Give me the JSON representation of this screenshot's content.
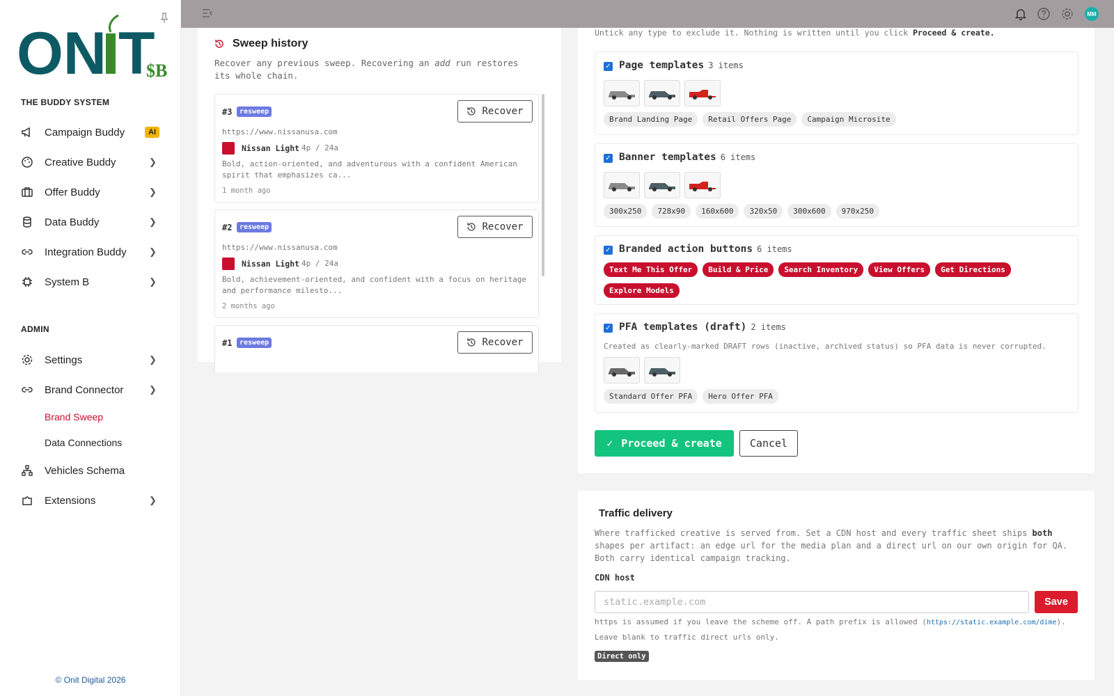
{
  "brand": {
    "logo_text": "ONiT",
    "logo_sub": "$B",
    "section_label": "THE BUDDY SYSTEM",
    "copyright": "© Onit Digital 2026"
  },
  "nav": [
    {
      "label": "Campaign Buddy",
      "icon": "megaphone-icon",
      "badge": "AI"
    },
    {
      "label": "Creative Buddy",
      "icon": "palette-icon"
    },
    {
      "label": "Offer Buddy",
      "icon": "briefcase-icon"
    },
    {
      "label": "Data Buddy",
      "icon": "database-icon"
    },
    {
      "label": "Integration Buddy",
      "icon": "link-icon"
    },
    {
      "label": "System B",
      "icon": "chip-icon"
    }
  ],
  "admin": {
    "label": "ADMIN",
    "items": [
      {
        "label": "Settings",
        "icon": "gear-icon"
      },
      {
        "label": "Brand Connector",
        "icon": "link-icon"
      },
      {
        "label": "Brand Sweep",
        "sub": true,
        "active": true
      },
      {
        "label": "Data Connections",
        "sub": true
      },
      {
        "label": "Vehicles Schema",
        "icon": "hierarchy-icon"
      },
      {
        "label": "Extensions",
        "icon": "puzzle-icon"
      }
    ]
  },
  "topbar": {
    "avatar_initials": "MM"
  },
  "history": {
    "title": "Sweep history",
    "desc_pre": "Recover any previous sweep. Recovering an ",
    "desc_em": "add",
    "desc_post": " run restores its whole chain.",
    "recover_label": "Recover",
    "entries": [
      {
        "num": "#3",
        "badge": "resweep",
        "url": "https://www.nissanusa.com",
        "brand": "Nissan Light",
        "meta": "4p / 24a",
        "summary": "Bold, action-oriented, and adventurous with a confident American spirit that emphasizes ca...",
        "ago": "1 month ago"
      },
      {
        "num": "#2",
        "badge": "resweep",
        "url": "https://www.nissanusa.com",
        "brand": "Nissan Light",
        "meta": "4p / 24a",
        "summary": "Bold, achievement-oriented, and confident with a focus on heritage and performance milesto...",
        "ago": "2 months ago"
      },
      {
        "num": "#1",
        "badge": "resweep"
      }
    ]
  },
  "review": {
    "intro_pre": "Untick any type to exclude it. Nothing is written until you click ",
    "intro_b": "Proceed & create.",
    "groups": {
      "page": {
        "title": "Page templates",
        "count": "3 items",
        "chips": [
          "Brand Landing Page",
          "Retail Offers Page",
          "Campaign Microsite"
        ]
      },
      "banner": {
        "title": "Banner templates",
        "count": "6 items",
        "chips": [
          "300x250",
          "728x90",
          "160x600",
          "320x50",
          "300x600",
          "970x250"
        ]
      },
      "buttons": {
        "title": "Branded action buttons",
        "count": "6 items",
        "chips": [
          "Text Me This Offer",
          "Build & Price",
          "Search Inventory",
          "View Offers",
          "Get Directions",
          "Explore Models"
        ]
      },
      "pfa": {
        "title": "PFA templates (draft)",
        "count": "2 items",
        "note": "Created as clearly-marked DRAFT rows (inactive, archived status) so PFA data is never corrupted.",
        "chips": [
          "Standard Offer PFA",
          "Hero Offer PFA"
        ]
      }
    },
    "proceed_label": "Proceed & create",
    "cancel_label": "Cancel"
  },
  "traffic": {
    "title": "Traffic delivery",
    "desc_pre": "Where trafficked creative is served from. Set a CDN host and every traffic sheet ships ",
    "desc_b": "both",
    "desc_post": " shapes per artifact: an edge url for the media plan and a direct url on our own origin for QA. Both carry identical campaign tracking.",
    "cdn_label": "CDN host",
    "cdn_placeholder": "static.example.com",
    "cdn_value": "",
    "save_label": "Save",
    "help1_pre": "https is assumed if you leave the scheme off. A path prefix is allowed (",
    "help1_example": "https://static.example.com/dime",
    "help1_post": ").",
    "help2": "Leave blank to traffic direct urls only.",
    "status_badge": "Direct only"
  }
}
